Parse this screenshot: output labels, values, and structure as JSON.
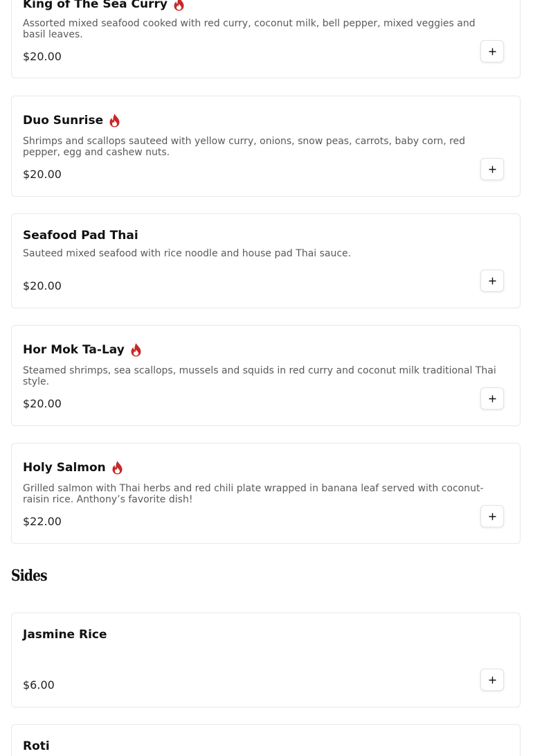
{
  "colors": {
    "accent_spicy": "#c62828",
    "card_border": "#e8e8e8",
    "text_primary": "#111111",
    "text_secondary": "#5a5a5a"
  },
  "icons": {
    "spicy": "flame-icon",
    "add": "plus-icon"
  },
  "menu": {
    "items": [
      {
        "name": "King of The Sea Curry",
        "spicy": true,
        "description": "Assorted mixed seafood cooked with red curry, coconut milk, bell pepper, mixed veggies and basil leaves.",
        "price": "$20.00"
      },
      {
        "name": "Duo Sunrise",
        "spicy": true,
        "description": "Shrimps and scallops sauteed with yellow curry, onions, snow peas, carrots, baby corn, red pepper, egg and cashew nuts.",
        "price": "$20.00"
      },
      {
        "name": "Seafood Pad Thai",
        "spicy": false,
        "description": "Sauteed mixed seafood with rice noodle and house pad Thai sauce.",
        "price": "$20.00"
      },
      {
        "name": "Hor Mok Ta-Lay",
        "spicy": true,
        "description": "Steamed shrimps, sea scallops, mussels and squids in red curry and coconut milk traditional Thai style.",
        "price": "$20.00"
      },
      {
        "name": "Holy Salmon",
        "spicy": true,
        "description": "Grilled salmon with Thai herbs and red chili plate wrapped in banana leaf served with coconut-raisin rice. Anthony’s favorite dish!",
        "price": "$22.00"
      }
    ]
  },
  "sides": {
    "heading": "Sides",
    "items": [
      {
        "name": "Jasmine Rice",
        "spicy": false,
        "description": "",
        "price": "$6.00"
      },
      {
        "name": "Roti",
        "spicy": false,
        "description": "",
        "price": ""
      }
    ]
  }
}
